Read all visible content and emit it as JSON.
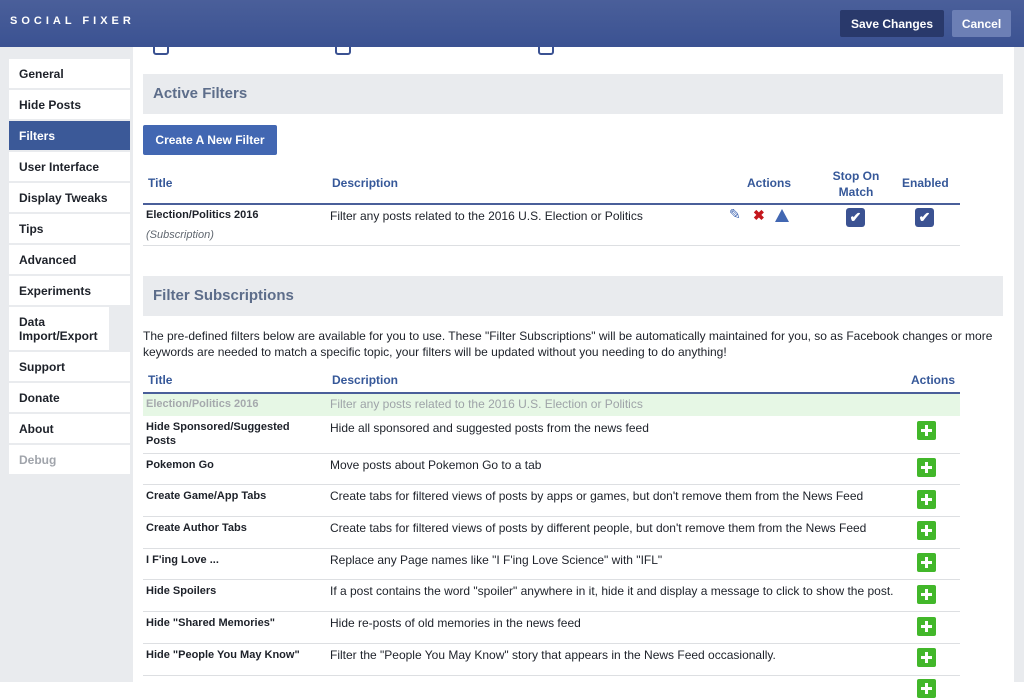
{
  "app": {
    "brand": "SOCIAL FIXER"
  },
  "toolbar": {
    "save_label": "Save Changes",
    "cancel_label": "Cancel"
  },
  "sidebar": {
    "items": [
      {
        "label": "General"
      },
      {
        "label": "Hide Posts"
      },
      {
        "label": "Filters"
      },
      {
        "label": "User Interface"
      },
      {
        "label": "Display Tweaks"
      },
      {
        "label": "Tips"
      },
      {
        "label": "Advanced"
      },
      {
        "label": "Experiments"
      },
      {
        "label": "Data Import/Export"
      },
      {
        "label": "Support"
      },
      {
        "label": "Donate"
      },
      {
        "label": "About"
      },
      {
        "label": "Debug"
      }
    ]
  },
  "active_filters": {
    "heading": "Active Filters",
    "new_button": "Create A New Filter",
    "columns": {
      "title": "Title",
      "description": "Description",
      "actions": "Actions",
      "stop": "Stop On Match",
      "enabled": "Enabled"
    },
    "rows": [
      {
        "title": "Election/Politics 2016",
        "subtitle": "(Subscription)",
        "description": "Filter any posts related to the 2016 U.S. Election or Politics",
        "stop_on_match": true,
        "enabled": true
      }
    ]
  },
  "subscriptions": {
    "heading": "Filter Subscriptions",
    "intro": "The pre-defined filters below are available for you to use. These \"Filter Subscriptions\" will be automatically maintained for you, so as Facebook changes or more keywords are needed to match a specific topic, your filters will be updated without you needing to do anything!",
    "columns": {
      "title": "Title",
      "description": "Description",
      "actions": "Actions"
    },
    "rows": [
      {
        "title": "Election/Politics 2016",
        "description": "Filter any posts related to the 2016 U.S. Election or Politics"
      },
      {
        "title": "Hide Sponsored/Suggested Posts",
        "description": "Hide all sponsored and suggested posts from the news feed"
      },
      {
        "title": "Pokemon Go",
        "description": "Move posts about Pokemon Go to a tab"
      },
      {
        "title": "Create Game/App Tabs",
        "description": "Create tabs for filtered views of posts by apps or games, but don't remove them from the News Feed"
      },
      {
        "title": "Create Author Tabs",
        "description": "Create tabs for filtered views of posts by different people, but don't remove them from the News Feed"
      },
      {
        "title": "I F'ing Love ...",
        "description": "Replace any Page names like \"I F'ing Love Science\" with \"IFL\""
      },
      {
        "title": "Hide Spoilers",
        "description": "If a post contains the word \"spoiler\" anywhere in it, hide it and display a message to click to show the post."
      },
      {
        "title": "Hide \"Shared Memories\"",
        "description": "Hide re-posts of old memories in the news feed"
      },
      {
        "title": "Hide \"People You May Know\"",
        "description": "Filter the \"People You May Know\" story that appears in the News Feed occasionally."
      }
    ]
  },
  "icons": {
    "edit": "pencil-icon",
    "delete": "delete-x-icon",
    "move_up": "arrow-up-icon",
    "check": "checkmark-icon",
    "add": "plus-icon"
  },
  "colors": {
    "brand": "#3b5292",
    "accent": "#4267b2",
    "add": "#42b72a",
    "delete": "#c4161c"
  }
}
